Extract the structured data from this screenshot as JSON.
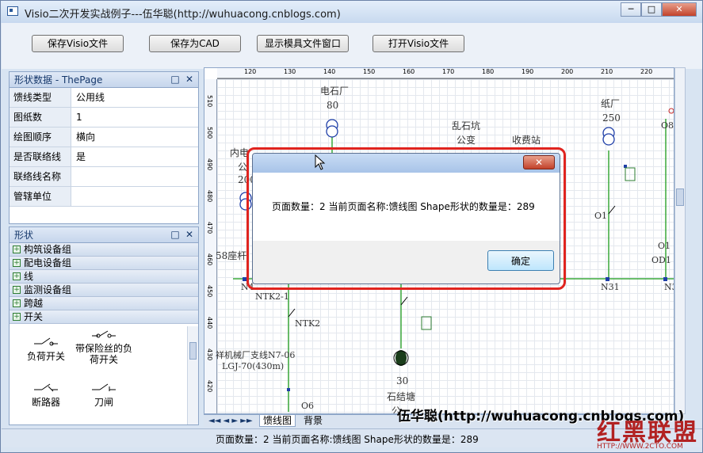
{
  "window": {
    "title": "Visio二次开发实战例子---伍华聪(http://wuhuacong.cnblogs.com)",
    "min_glyph": "─",
    "max_glyph": "□",
    "close_glyph": "✕"
  },
  "toolbar": {
    "save_visio": "保存Visio文件",
    "save_cad": "保存为CAD",
    "show_stencil": "显示模具文件窗口",
    "open_visio": "打开Visio文件"
  },
  "shape_data": {
    "header": "形状数据 - ThePage",
    "rows": [
      {
        "k": "馈线类型",
        "v": "公用线"
      },
      {
        "k": "图纸数",
        "v": "1"
      },
      {
        "k": "绘图顺序",
        "v": "横向"
      },
      {
        "k": "是否联络线",
        "v": "是"
      },
      {
        "k": "联络线名称",
        "v": ""
      },
      {
        "k": "管辖单位",
        "v": ""
      }
    ]
  },
  "shapes_panel": {
    "header": "形状",
    "groups": [
      "构筑设备组",
      "配电设备组",
      "线",
      "监测设备组",
      "跨越",
      "开关"
    ],
    "stencils": [
      {
        "label": "负荷开关"
      },
      {
        "label": "带保险丝的负荷开关"
      },
      {
        "label": "断路器"
      },
      {
        "label": "刀闸"
      }
    ]
  },
  "ruler": {
    "top": [
      "120",
      "130",
      "140",
      "150",
      "160",
      "170",
      "180",
      "190",
      "200",
      "210",
      "220"
    ],
    "left": [
      "510",
      "500",
      "490",
      "480",
      "470",
      "460",
      "450",
      "440",
      "430",
      "420",
      "410"
    ]
  },
  "drawing_labels": {
    "dianshi": "电石厂",
    "dianshi_num": "80",
    "luanshi": "乱石坑",
    "gongbian": "公变",
    "shoufei": "收费站",
    "zhichang": "纸厂",
    "zhichang_num": "250",
    "neidian": "内电",
    "gong": "公",
    "num200": "200",
    "zuo58": "58座杆",
    "n4": "N4",
    "ntk21": "NTK2-1",
    "ntk2": "NTK2",
    "branch": "祥机械厂支线N7-06",
    "lgj": "LGJ-70(430m)",
    "o6": "O6",
    "num30": "30",
    "shijie": "石结塘",
    "o1": "O1",
    "o8": "O8",
    "o10": "O1",
    "od1": "OD1",
    "n31": "N31",
    "n3": "N3",
    "gong2": "公"
  },
  "tabs": {
    "nav_glyphs": "◄◄ ◄ ► ►►",
    "tab1": "馈线图",
    "tab2": "背景"
  },
  "status": {
    "text": "页面数量：2 当前页面名称:馈线图 Shape形状的数量是：289"
  },
  "dialog": {
    "message": "页面数量：2 当前页面名称:馈线图 Shape形状的数量是：289",
    "ok": "确定",
    "close_glyph": "✕"
  },
  "watermark": {
    "text": "伍华聪(http://wuhuacong.cnblogs.com)",
    "logo": "红黑联盟",
    "logo_url": "HTTP://WWW.2CTO.COM"
  },
  "colors": {
    "accent": "#e0241f",
    "wire": "#3aa83a",
    "node": "#1f3fa8"
  }
}
